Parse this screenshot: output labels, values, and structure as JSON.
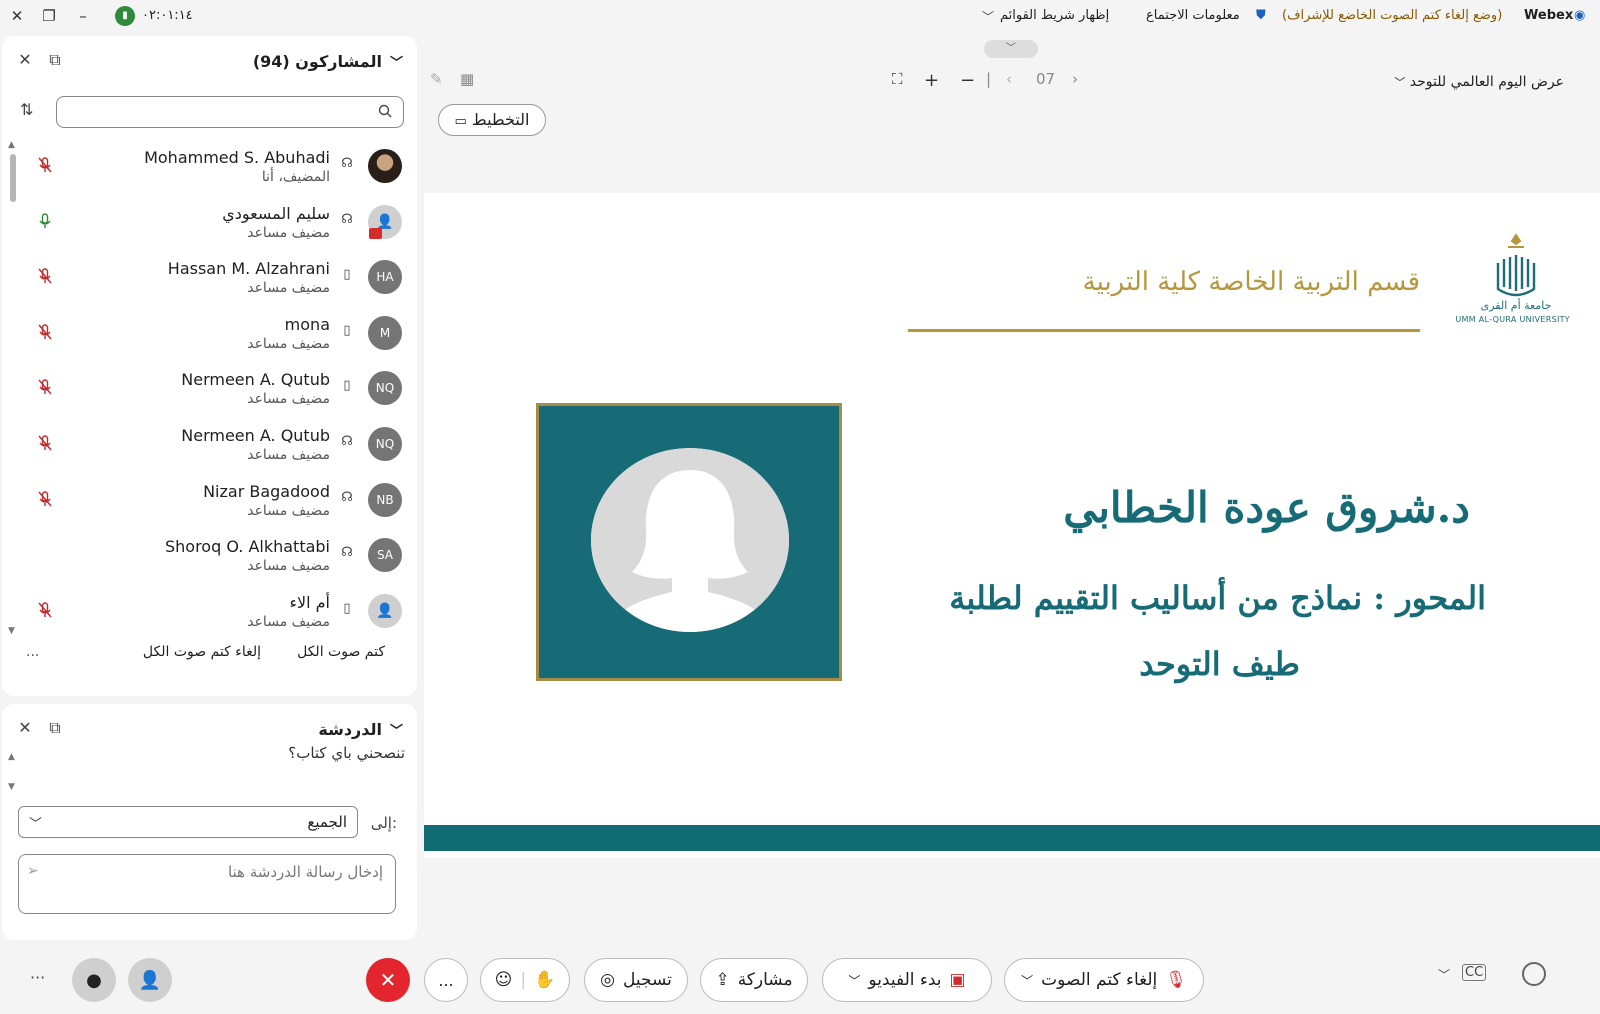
{
  "titlebar": {
    "app_name": "Webex",
    "mode_label": "(وضع إلغاء كتم الصوت الخاضع للإشراف)",
    "meeting_info": "معلومات الاجتماع",
    "show_menu_bar": "إظهار شريط القوائم",
    "timer": "٠٢:٠١:١٤"
  },
  "participants_panel": {
    "title": "المشاركون (94)",
    "search": {
      "value": "",
      "placeholder": ""
    },
    "rows": [
      {
        "name": "Mohammed S. Abuhadi",
        "role": "المضيف، أنا",
        "avatar": "",
        "avatar_type": "photo",
        "device": "headset-icon",
        "mic": "muted"
      },
      {
        "name": "سليم المسعودي",
        "role": "مضيف مساعد",
        "avatar": "",
        "avatar_type": "gray",
        "device": "headset-icon",
        "mic": "unmuted"
      },
      {
        "name": "Hassan M. Alzahrani",
        "role": "مضيف مساعد",
        "avatar": "HA",
        "avatar_type": "initials",
        "device": "phone-icon",
        "mic": "muted"
      },
      {
        "name": "mona",
        "role": "مضيف مساعد",
        "avatar": "M",
        "avatar_type": "initials",
        "device": "phone-icon",
        "mic": "muted"
      },
      {
        "name": "Nermeen A. Qutub",
        "role": "مضيف مساعد",
        "avatar": "NQ",
        "avatar_type": "initials",
        "device": "phone-icon",
        "mic": "muted"
      },
      {
        "name": "Nermeen A. Qutub",
        "role": "مضيف مساعد",
        "avatar": "NQ",
        "avatar_type": "initials",
        "device": "headset-icon",
        "mic": "muted"
      },
      {
        "name": "Nizar Bagadood",
        "role": "مضيف مساعد",
        "avatar": "NB",
        "avatar_type": "initials",
        "device": "headset-icon",
        "mic": "muted"
      },
      {
        "name": "Shoroq O. Alkhattabi",
        "role": "مضيف مساعد",
        "avatar": "SA",
        "avatar_type": "initials",
        "device": "headset-icon",
        "mic": "none"
      },
      {
        "name": "أم الاء",
        "role": "مضيف مساعد",
        "avatar": "",
        "avatar_type": "gray",
        "device": "phone-icon",
        "mic": "muted"
      }
    ],
    "mute_all": "كتم صوت الكل",
    "unmute_all": "إلغاء كتم صوت الكل",
    "more": "..."
  },
  "chat_panel": {
    "title": "الدردشة",
    "message": "تنصحني باي كتاب؟",
    "to_label": "إلى:",
    "to_value": "الجميع",
    "input_placeholder": "إدخال رسالة الدردشة هنا"
  },
  "presentation": {
    "share_title": "عرض اليوم العالمي للتوحد",
    "page_number": "07",
    "layout_button": "التخطيط",
    "slide": {
      "department": "قسم التربية الخاصة كلية التربية",
      "presenter_name": "د.شروق عودة الخطابي",
      "topic_line1": "المحور : نماذج من أساليب التقييم لطلبة",
      "topic_line2": "طيف التوحد",
      "logo_text": "UMM AL-QURA UNIVERSITY",
      "logo_arabic": "جامعة أم القرى"
    }
  },
  "controls": {
    "unmute": "إلغاء كتم الصوت",
    "start_video": "بدء الفيديو",
    "share": "مشاركة",
    "record": "تسجيل",
    "more": "..."
  },
  "colors": {
    "teal": "#166b77",
    "gold": "#b5973d",
    "end_red": "#e3262d",
    "mode_text": "#8a5a00"
  }
}
